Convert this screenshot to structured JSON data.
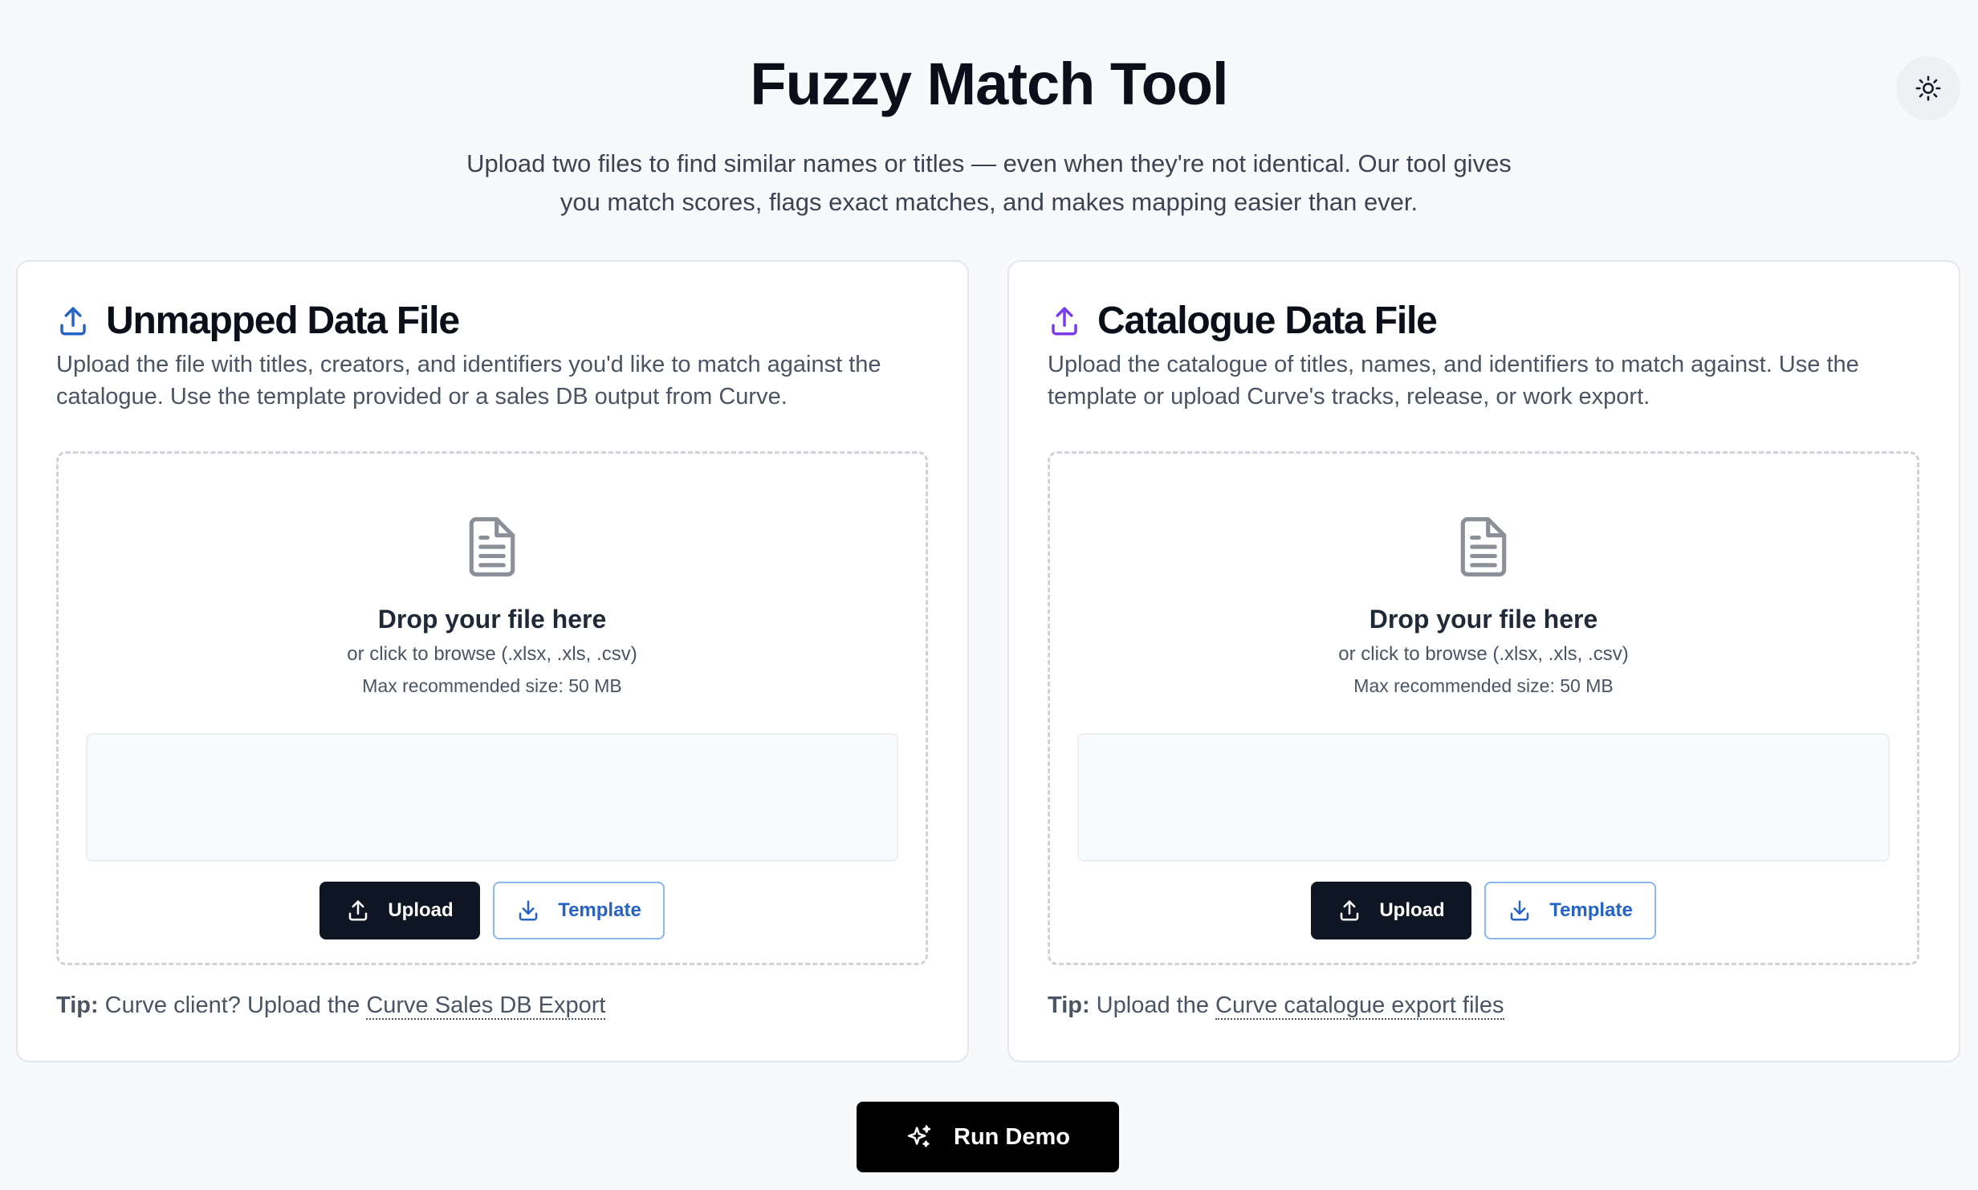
{
  "header": {
    "title": "Fuzzy Match Tool",
    "subtitle": "Upload two files to find similar names or titles — even when they're not identical. Our tool gives you match scores, flags exact matches, and makes mapping easier than ever.",
    "theme_toggle_icon": "sun-icon"
  },
  "cards": [
    {
      "title": "Unmapped Data File",
      "icon": "upload-icon",
      "icon_color": "#2563c4",
      "description": "Upload the file with titles, creators, and identifiers you'd like to match against the catalogue. Use the template provided or a sales DB output from Curve.",
      "dropzone": {
        "icon": "document-icon",
        "title": "Drop your file here",
        "hint": "or click to browse (.xlsx, .xls, .csv)",
        "size": "Max recommended size: 50 MB"
      },
      "upload_label": "Upload",
      "template_label": "Template",
      "tip_label": "Tip:",
      "tip_text": " Curve client? Upload the ",
      "tip_link": "Curve Sales DB Export"
    },
    {
      "title": "Catalogue Data File",
      "icon": "upload-icon",
      "icon_color": "#7c3aed",
      "description": "Upload the catalogue of titles, names, and identifiers to match against. Use the template or upload Curve's tracks, release, or work export.",
      "dropzone": {
        "icon": "document-icon",
        "title": "Drop your file here",
        "hint": "or click to browse (.xlsx, .xls, .csv)",
        "size": "Max recommended size: 50 MB"
      },
      "upload_label": "Upload",
      "template_label": "Template",
      "tip_label": "Tip:",
      "tip_text": " Upload the ",
      "tip_link": "Curve catalogue export files"
    }
  ],
  "demo_button": {
    "label": "Run Demo",
    "icon": "sparkles-icon"
  }
}
